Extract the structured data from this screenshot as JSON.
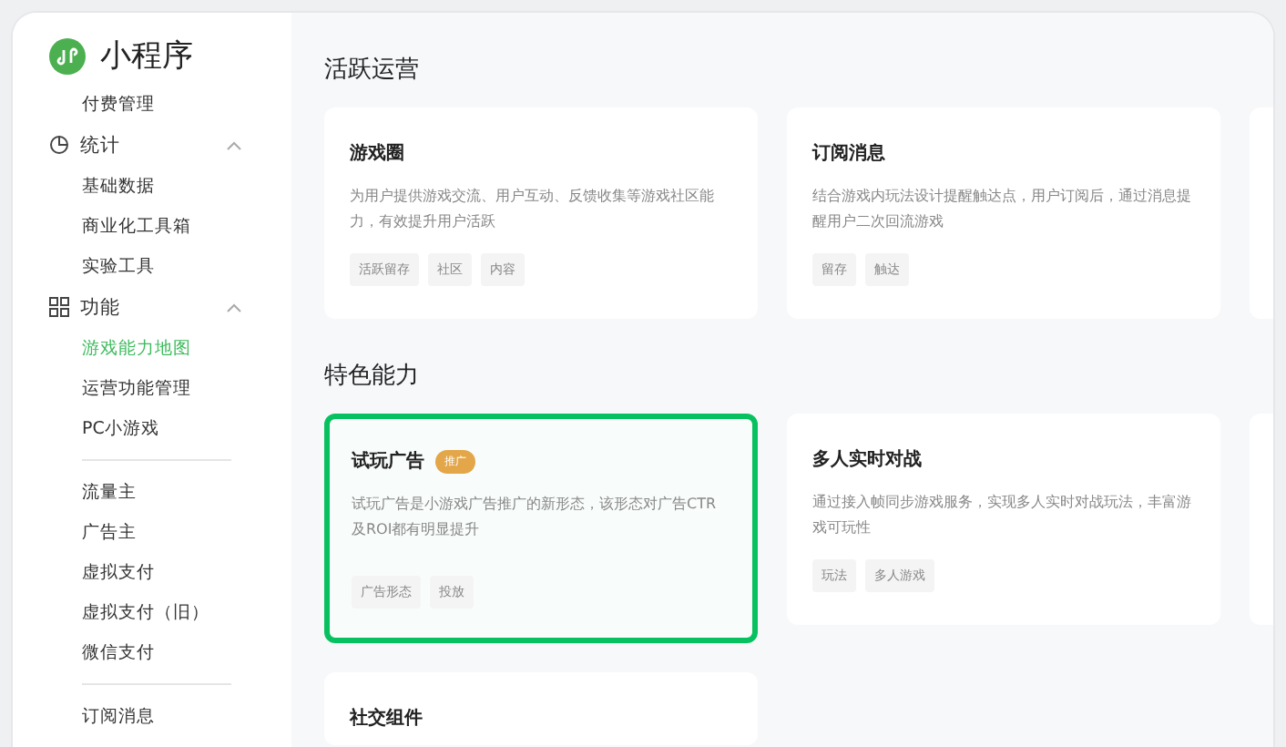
{
  "app": {
    "title": "小程序"
  },
  "sidebar": {
    "items": [
      {
        "kind": "link",
        "label": "付费管理",
        "selected": false
      },
      {
        "kind": "group",
        "label": "统计",
        "expanded": true,
        "children": [
          {
            "label": "基础数据",
            "selected": false
          },
          {
            "label": "商业化工具箱",
            "selected": false
          },
          {
            "label": "实验工具",
            "selected": false
          }
        ]
      },
      {
        "kind": "group",
        "label": "功能",
        "expanded": true,
        "children": [
          {
            "label": "游戏能力地图",
            "selected": true
          },
          {
            "label": "运营功能管理",
            "selected": false
          },
          {
            "label": "PC小游戏",
            "selected": false
          }
        ]
      },
      {
        "kind": "divider"
      },
      {
        "kind": "link",
        "label": "流量主",
        "selected": false
      },
      {
        "kind": "link",
        "label": "广告主",
        "selected": false
      },
      {
        "kind": "link",
        "label": "虚拟支付",
        "selected": false
      },
      {
        "kind": "link",
        "label": "虚拟支付（旧）",
        "selected": false
      },
      {
        "kind": "link",
        "label": "微信支付",
        "selected": false
      },
      {
        "kind": "divider"
      },
      {
        "kind": "link",
        "label": "订阅消息",
        "selected": false
      }
    ]
  },
  "sections": [
    {
      "title": "活跃运营",
      "cards": [
        {
          "title": "游戏圈",
          "description": "为用户提供游戏交流、用户互动、反馈收集等游戏社区能力，有效提升用户活跃",
          "tags": [
            "活跃留存",
            "社区",
            "内容"
          ],
          "highlighted": false
        },
        {
          "title": "订阅消息",
          "description": "结合游戏内玩法设计提醒触达点，用户订阅后，通过消息提醒用户二次回流游戏",
          "tags": [
            "留存",
            "触达"
          ],
          "highlighted": false
        }
      ]
    },
    {
      "title": "特色能力",
      "cards": [
        {
          "title": "试玩广告",
          "badge": "推广",
          "description": "试玩广告是小游戏广告推广的新形态，该形态对广告CTR及ROI都有明显提升",
          "tags": [
            "广告形态",
            "投放"
          ],
          "highlighted": true
        },
        {
          "title": "多人实时对战",
          "description": "通过接入帧同步游戏服务，实现多人实时对战玩法，丰富游戏可玩性",
          "tags": [
            "玩法",
            "多人游戏"
          ],
          "highlighted": false
        },
        {
          "title": "社交组件",
          "highlighted": false
        }
      ]
    }
  ]
}
